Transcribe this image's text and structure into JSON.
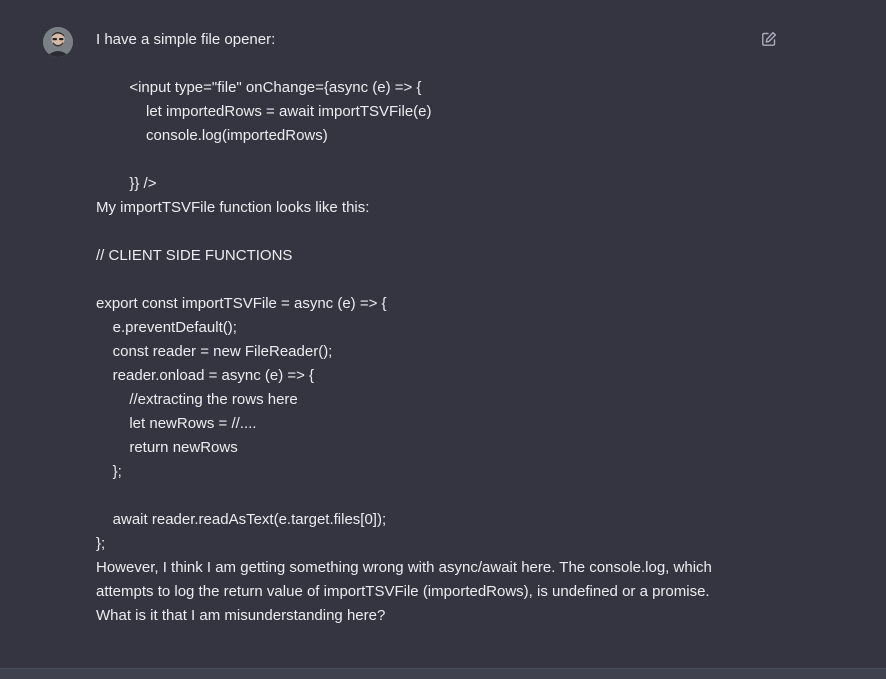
{
  "message": {
    "lines": [
      "I have a simple file opener:",
      "",
      "        <input type=\"file\" onChange={async (e) => {",
      "            let importedRows = await importTSVFile(e)",
      "            console.log(importedRows)",
      "",
      "        }} />",
      "My importTSVFile function looks like this:",
      "",
      "// CLIENT SIDE FUNCTIONS",
      "",
      "export const importTSVFile = async (e) => {",
      "    e.preventDefault();",
      "    const reader = new FileReader();",
      "    reader.onload = async (e) => {",
      "        //extracting the rows here",
      "        let newRows = //....",
      "        return newRows",
      "    };",
      "",
      "    await reader.readAsText(e.target.files[0]);",
      "};"
    ],
    "closing_paragraph": "However, I think I am getting something wrong with async/await here. The console.log, which attempts to log the return value of importTSVFile (importedRows), is undefined or a promise. What is it that I am misunderstanding here?"
  },
  "icons": {
    "avatar": "user-avatar",
    "edit": "edit-icon"
  },
  "colors": {
    "background": "#343541",
    "text": "#ececf1",
    "icon": "#acacbe"
  }
}
